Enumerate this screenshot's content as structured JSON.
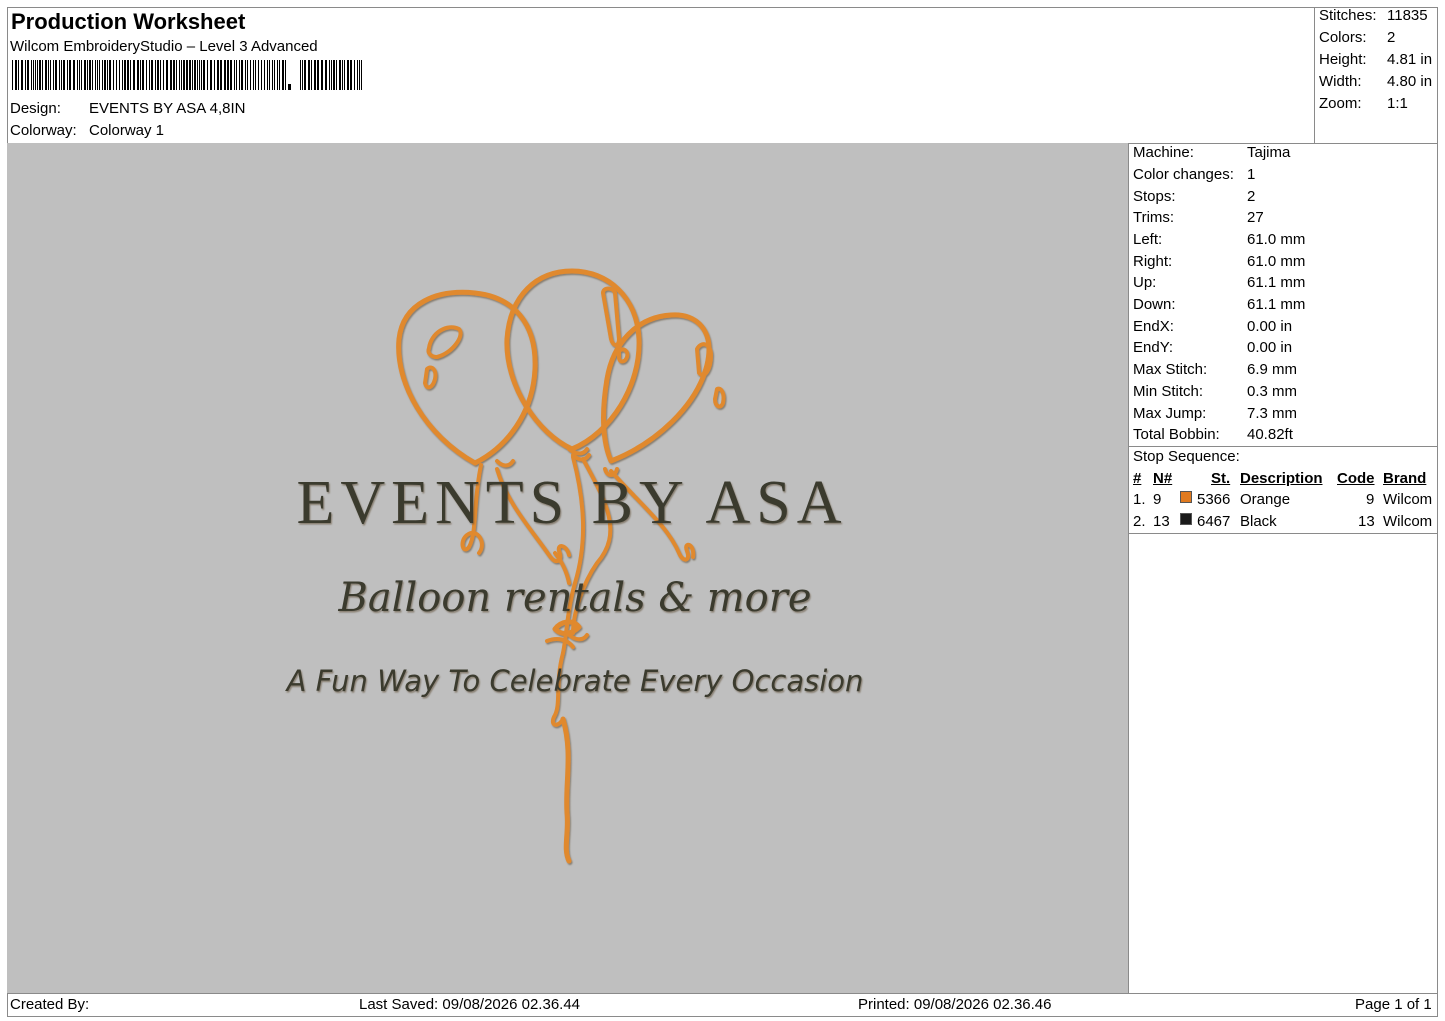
{
  "header": {
    "title": "Production Worksheet",
    "software": "Wilcom EmbroideryStudio – Level 3 Advanced",
    "design_label": "Design:",
    "design_value": "EVENTS BY ASA 4,8IN",
    "colorway_label": "Colorway:",
    "colorway_value": "Colorway 1"
  },
  "summary": [
    {
      "label": "Stitches:",
      "value": "11835"
    },
    {
      "label": "Colors:",
      "value": "2"
    },
    {
      "label": "Height:",
      "value": "4.81 in"
    },
    {
      "label": "Width:",
      "value": "4.80 in"
    },
    {
      "label": "Zoom:",
      "value": "1:1"
    }
  ],
  "machine_info": [
    {
      "label": "Machine:",
      "value": "Tajima"
    },
    {
      "label": "Color changes:",
      "value": "1"
    },
    {
      "label": "Stops:",
      "value": "2"
    },
    {
      "label": "Trims:",
      "value": "27"
    },
    {
      "label": "Left:",
      "value": "61.0 mm"
    },
    {
      "label": "Right:",
      "value": "61.0 mm"
    },
    {
      "label": "Up:",
      "value": "61.1 mm"
    },
    {
      "label": "Down:",
      "value": "61.1 mm"
    },
    {
      "label": "EndX:",
      "value": "0.00 in"
    },
    {
      "label": "EndY:",
      "value": "0.00 in"
    },
    {
      "label": "Max Stitch:",
      "value": "6.9 mm"
    },
    {
      "label": "Min Stitch:",
      "value": "0.3 mm"
    },
    {
      "label": "Max Jump:",
      "value": "7.3 mm"
    },
    {
      "label": "Total Bobbin:",
      "value": "40.82ft"
    }
  ],
  "stop_sequence": {
    "title": "Stop Sequence:",
    "columns": [
      "#",
      "N#",
      "St.",
      "Description",
      "Code",
      "Brand"
    ],
    "rows": [
      {
        "index": "1.",
        "n": "9",
        "color": "#e07a1f",
        "st": "5366",
        "description": "Orange",
        "code": "9",
        "brand": "Wilcom"
      },
      {
        "index": "2.",
        "n": "13",
        "color": "#1a1a1a",
        "st": "6467",
        "description": "Black",
        "code": "13",
        "brand": "Wilcom"
      }
    ]
  },
  "design_preview": {
    "line1": "EVENTS BY ASA",
    "line2": "Balloon rentals & more",
    "line3": "A Fun Way To Celebrate Every Occasion",
    "thread_orange": "#e0892e",
    "thread_dark": "#3a3a2e"
  },
  "footer": {
    "created_by": "Created By:",
    "last_saved": "Last Saved: 09/08/2026 02.36.44",
    "printed": "Printed: 09/08/2026 02.36.46",
    "page": "Page 1 of 1"
  }
}
